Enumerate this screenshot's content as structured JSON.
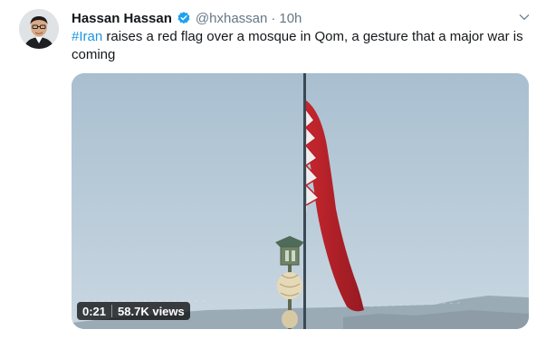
{
  "tweet": {
    "author_name": "Hassan Hassan",
    "handle": "@hxhassan",
    "separator": "·",
    "time": "10h",
    "text_hashtag": "#Iran",
    "text_body": " raises a red flag over a mosque in Qom, a gesture that a major war is coming"
  },
  "video": {
    "duration": "0:21",
    "views": "58.7K views"
  },
  "colors": {
    "link": "#1b95e0",
    "verified": "#1da1f2",
    "secondary_text": "#657786",
    "flag_red": "#b8202a"
  },
  "icons": {
    "verified": "verified-badge-icon",
    "caret": "chevron-down-icon"
  }
}
